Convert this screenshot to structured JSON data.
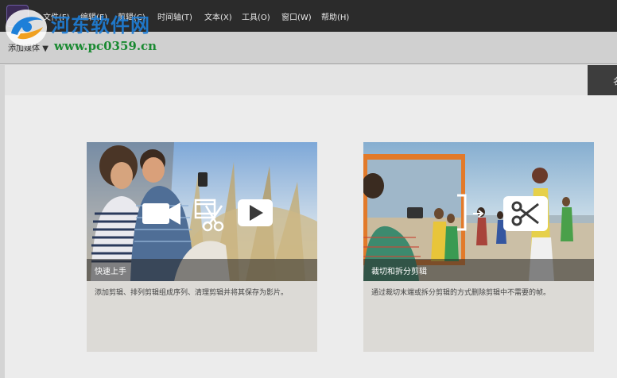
{
  "menubar": {
    "items": [
      "文件(F)",
      "编辑(E)",
      "剪辑(C)",
      "时间轴(T)",
      "文本(X)",
      "工具(O)",
      "窗口(W)",
      "帮助(H)"
    ]
  },
  "watermark": {
    "title": "河东软件网",
    "url": "www.pc0359.cn"
  },
  "toolbar": {
    "dropdown_label": "添加媒体"
  },
  "corner_button": {
    "label": "名"
  },
  "cards": [
    {
      "caption": "快速上手",
      "description": "添加剪辑、排列剪辑组成序列、清理剪辑并将其保存为影片。"
    },
    {
      "caption": "裁切和拆分剪辑",
      "description": "通过裁切末端或拆分剪辑的方式删除剪辑中不需要的帧。"
    }
  ],
  "colors": {
    "menubar_bg": "#2b2b2b",
    "toolbar_bg": "#d0d0d0",
    "content_bg": "#ececec",
    "card_bg": "#dcdad6",
    "watermark_blue": "#1e7fd8",
    "watermark_green": "#1a8a32"
  }
}
